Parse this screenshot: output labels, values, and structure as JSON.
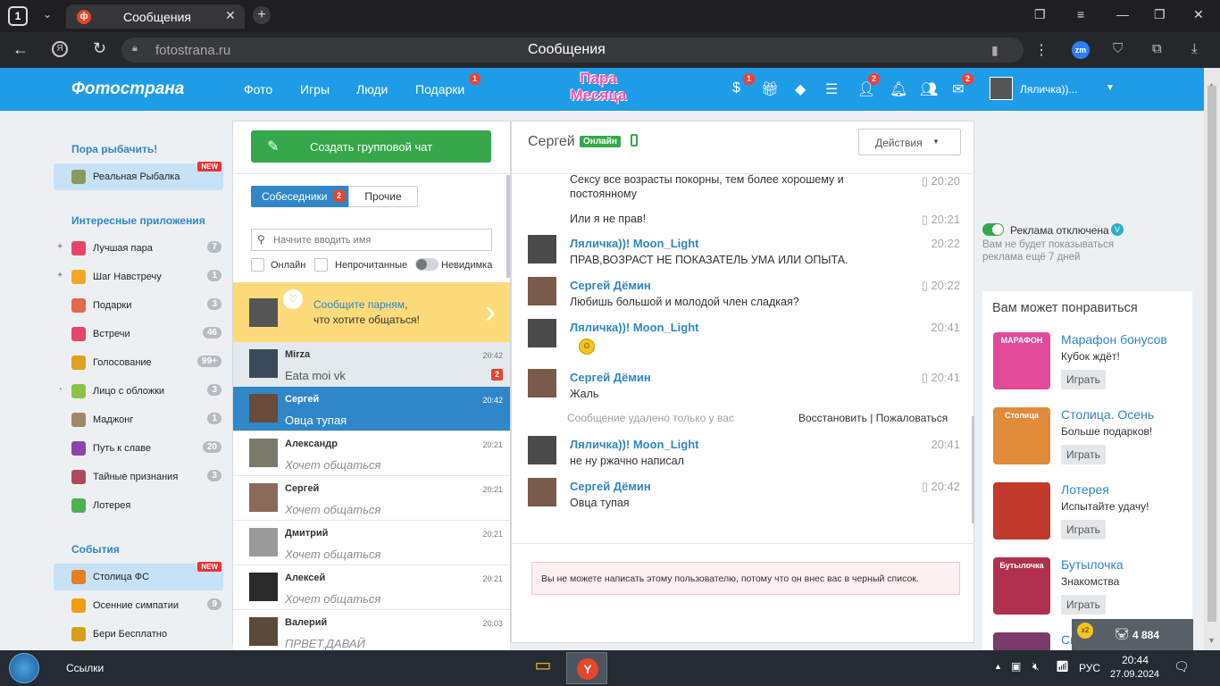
{
  "browser": {
    "tab_number": "1",
    "tab_title": "Сообщения",
    "url": "fotostrana.ru",
    "page_title": "Сообщения",
    "ext_label": "zm"
  },
  "site": {
    "logo": "Фотострана",
    "nav": [
      "Фото",
      "Игры",
      "Люди",
      "Подарки"
    ],
    "gifts_badge": "1",
    "center_logo_line1": "Пара",
    "center_logo_line2": "Месяца",
    "badges": {
      "s": "1",
      "people": "2",
      "mail": "2"
    },
    "username": "Ляличка))..."
  },
  "sidebar": {
    "promo_title": "Пора рыбачить!",
    "promo_item": "Реальная Рыбалка",
    "new_label": "NEW",
    "apps_title": "Интересные приложения",
    "apps": [
      {
        "label": "Лучшая пара",
        "count": "7",
        "color": "#e8456b"
      },
      {
        "label": "Шаг Навстречу",
        "count": "1",
        "color": "#f5a623"
      },
      {
        "label": "Подарки",
        "count": "3",
        "color": "#e06a4a"
      },
      {
        "label": "Встречи",
        "count": "46",
        "color": "#e8456b"
      },
      {
        "label": "Голосование",
        "count": "99+",
        "color": "#e0a020"
      },
      {
        "label": "Лицо с обложки",
        "count": "3",
        "color": "#8bc34a"
      },
      {
        "label": "Маджонг",
        "count": "1",
        "color": "#9e8a6a"
      },
      {
        "label": "Путь к славе",
        "count": "20",
        "color": "#8e44ad"
      },
      {
        "label": "Тайные признания",
        "count": "3",
        "color": "#b04a5a"
      },
      {
        "label": "Лотерея",
        "count": "",
        "color": "#4caf50"
      }
    ],
    "events_title": "События",
    "events": [
      {
        "label": "Столица ФС",
        "new": "NEW",
        "color": "#e67e22"
      },
      {
        "label": "Осенние симпатии",
        "count": "9",
        "color": "#f39c12"
      },
      {
        "label": "Бери Бесплатно",
        "color": "#d4a017"
      }
    ]
  },
  "contacts": {
    "create_group": "Создать групповой чат",
    "tab_interlocutors": "Собеседники",
    "tab_count": "2",
    "tab_other": "Прочие",
    "search_placeholder": "Начните вводить имя",
    "filter_online": "Онлайн",
    "filter_unread": "Непрочитанные",
    "filter_invisible": "Невидимка",
    "promo_line1_link": "Сообщите парням",
    "promo_line1_rest": ",",
    "promo_line2": "что хотите общаться!",
    "list": [
      {
        "name": "Mirza",
        "time": "20:42",
        "msg": "Eata moi vk",
        "unread": "2"
      },
      {
        "name": "Сергей",
        "time": "20:42",
        "msg": "Овца тупая"
      },
      {
        "name": "Александр",
        "time": "20:21",
        "msg": "Хочет общаться"
      },
      {
        "name": "Сергей",
        "time": "20:21",
        "msg": "Хочет общаться"
      },
      {
        "name": "Дмитрий",
        "time": "20:21",
        "msg": "Хочет общаться"
      },
      {
        "name": "Алексей",
        "time": "20:21",
        "msg": "Хочет общаться"
      },
      {
        "name": "Валерий",
        "time": "20:03",
        "msg": "ПРВЕТ.ДАВАЙ"
      }
    ]
  },
  "chat": {
    "contact_name": "Сергей",
    "status": "Онлайн",
    "actions": "Действия",
    "messages": [
      {
        "text": "Сексу все возрасты покорны, тем более хорошему и постоянному",
        "time": "20:20"
      },
      {
        "text": "Или я не прав!",
        "time": "20:21"
      },
      {
        "name": "Ляличка))! Moon_Light",
        "text": "ПРАВ,ВОЗРАСТ НЕ ПОКАЗАТЕЛЬ УМА ИЛИ ОПЫТА.",
        "time": "20:22"
      },
      {
        "name": "Сергей Дёмин",
        "text": "Любишь большой и молодой член сладкая?",
        "time": "20:22"
      },
      {
        "name": "Ляличка))! Moon_Light",
        "text": "",
        "time": "20:41"
      },
      {
        "name": "Сергей Дёмин",
        "text": "Жаль",
        "time": "20:41"
      },
      {
        "name": "Ляличка))! Moon_Light",
        "text": "не ну ржачно написал",
        "time": "20:41"
      },
      {
        "name": "Сергей Дёмин",
        "text": "Овца тупая",
        "time": "20:42"
      }
    ],
    "deleted_note": "Сообщение удалено только у вас",
    "restore": "Восстановить",
    "separator": "|",
    "report": "Пожаловаться",
    "blocked_notice": "Вы не можете написать этому пользователю, потому что он внес вас в черный список."
  },
  "right": {
    "ads_off": "Реклама отключена",
    "ads_sub1": "Вам не будет показываться",
    "ads_sub2": "реклама ещё 7 дней",
    "may_like": "Вам может понравиться",
    "recs": [
      {
        "title": "Марафон бонусов",
        "sub": "Кубок ждёт!",
        "btn": "Играть",
        "color": "#e24a9a",
        "img_text": "МАРАФОН"
      },
      {
        "title": "Столица. Осень",
        "sub": "Больше подарков!",
        "btn": "Играть",
        "color": "#e08a3a",
        "img_text": "Столица"
      },
      {
        "title": "Лотерея",
        "sub": "Испытайте удачу!",
        "btn": "Играть",
        "color": "#c0392b",
        "img_text": ""
      },
      {
        "title": "Бутылочка",
        "sub": "Знакомства",
        "btn": "Играть",
        "color": "#b03050",
        "img_text": "Бутылочка"
      },
      {
        "title": "Смотри и влюбляйся",
        "sub": "",
        "btn": "",
        "color": "#7a3a6a",
        "img_text": ""
      }
    ],
    "coins_x2": "x2",
    "coins": "4 884"
  },
  "taskbar": {
    "links": "Ссылки",
    "lang": "РУС",
    "time": "20:44",
    "date": "27.09.2024"
  }
}
